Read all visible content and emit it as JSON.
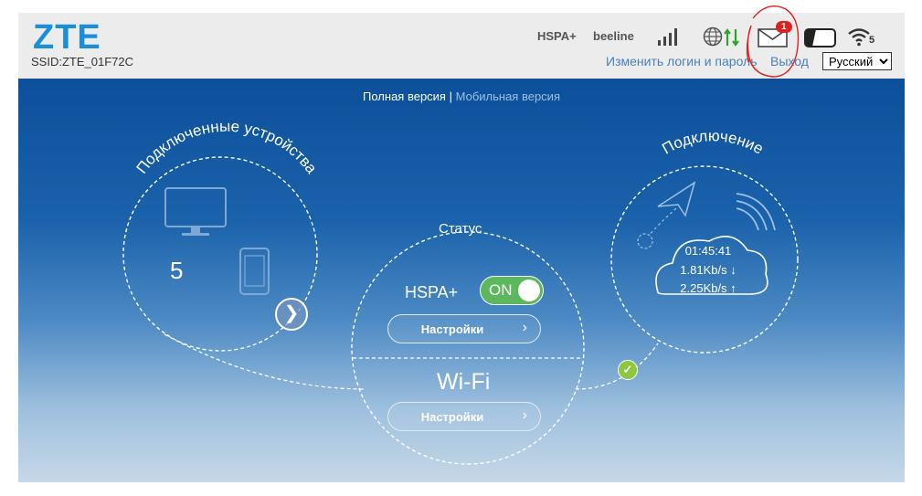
{
  "header": {
    "logo": "ZTE",
    "ssid": "SSID:ZTE_01F72C",
    "network_type": "HSPA+",
    "operator": "beeline",
    "messages_count": "1",
    "wifi_clients": "5",
    "change_login_link": "Изменить логин и пароль",
    "logout_link": "Выход",
    "language": {
      "selected": "Русский",
      "options": [
        "Русский"
      ]
    },
    "icons": [
      "signal-bars-icon",
      "globe-icon",
      "data-transfer-icon",
      "mail-icon",
      "battery-icon",
      "wifi-icon"
    ]
  },
  "version_switch": {
    "full": "Полная версия",
    "separator": "|",
    "mobile": "Мобильная версия"
  },
  "devices": {
    "title": "Подключенные устройства",
    "count": "5",
    "more_glyph": "❯"
  },
  "status": {
    "title": "Статус",
    "hspa_label": "HSPA+",
    "toggle_label": "ON",
    "settings_label_1": "Настройки",
    "wifi_label": "Wi-Fi",
    "settings_label_2": "Настройки",
    "chevron": "›"
  },
  "connection": {
    "title": "Подключение",
    "time": "01:45:41",
    "download": "1.81Kb/s ↓",
    "upload": "2.25Kb/s ↑",
    "check_glyph": "✓"
  },
  "colors": {
    "accent": "#1a8fd8",
    "link": "#4a7fb8",
    "toggle_on": "#5cb85c",
    "badge": "#e02020",
    "check": "#8dc63f",
    "annotation": "#e02020"
  }
}
